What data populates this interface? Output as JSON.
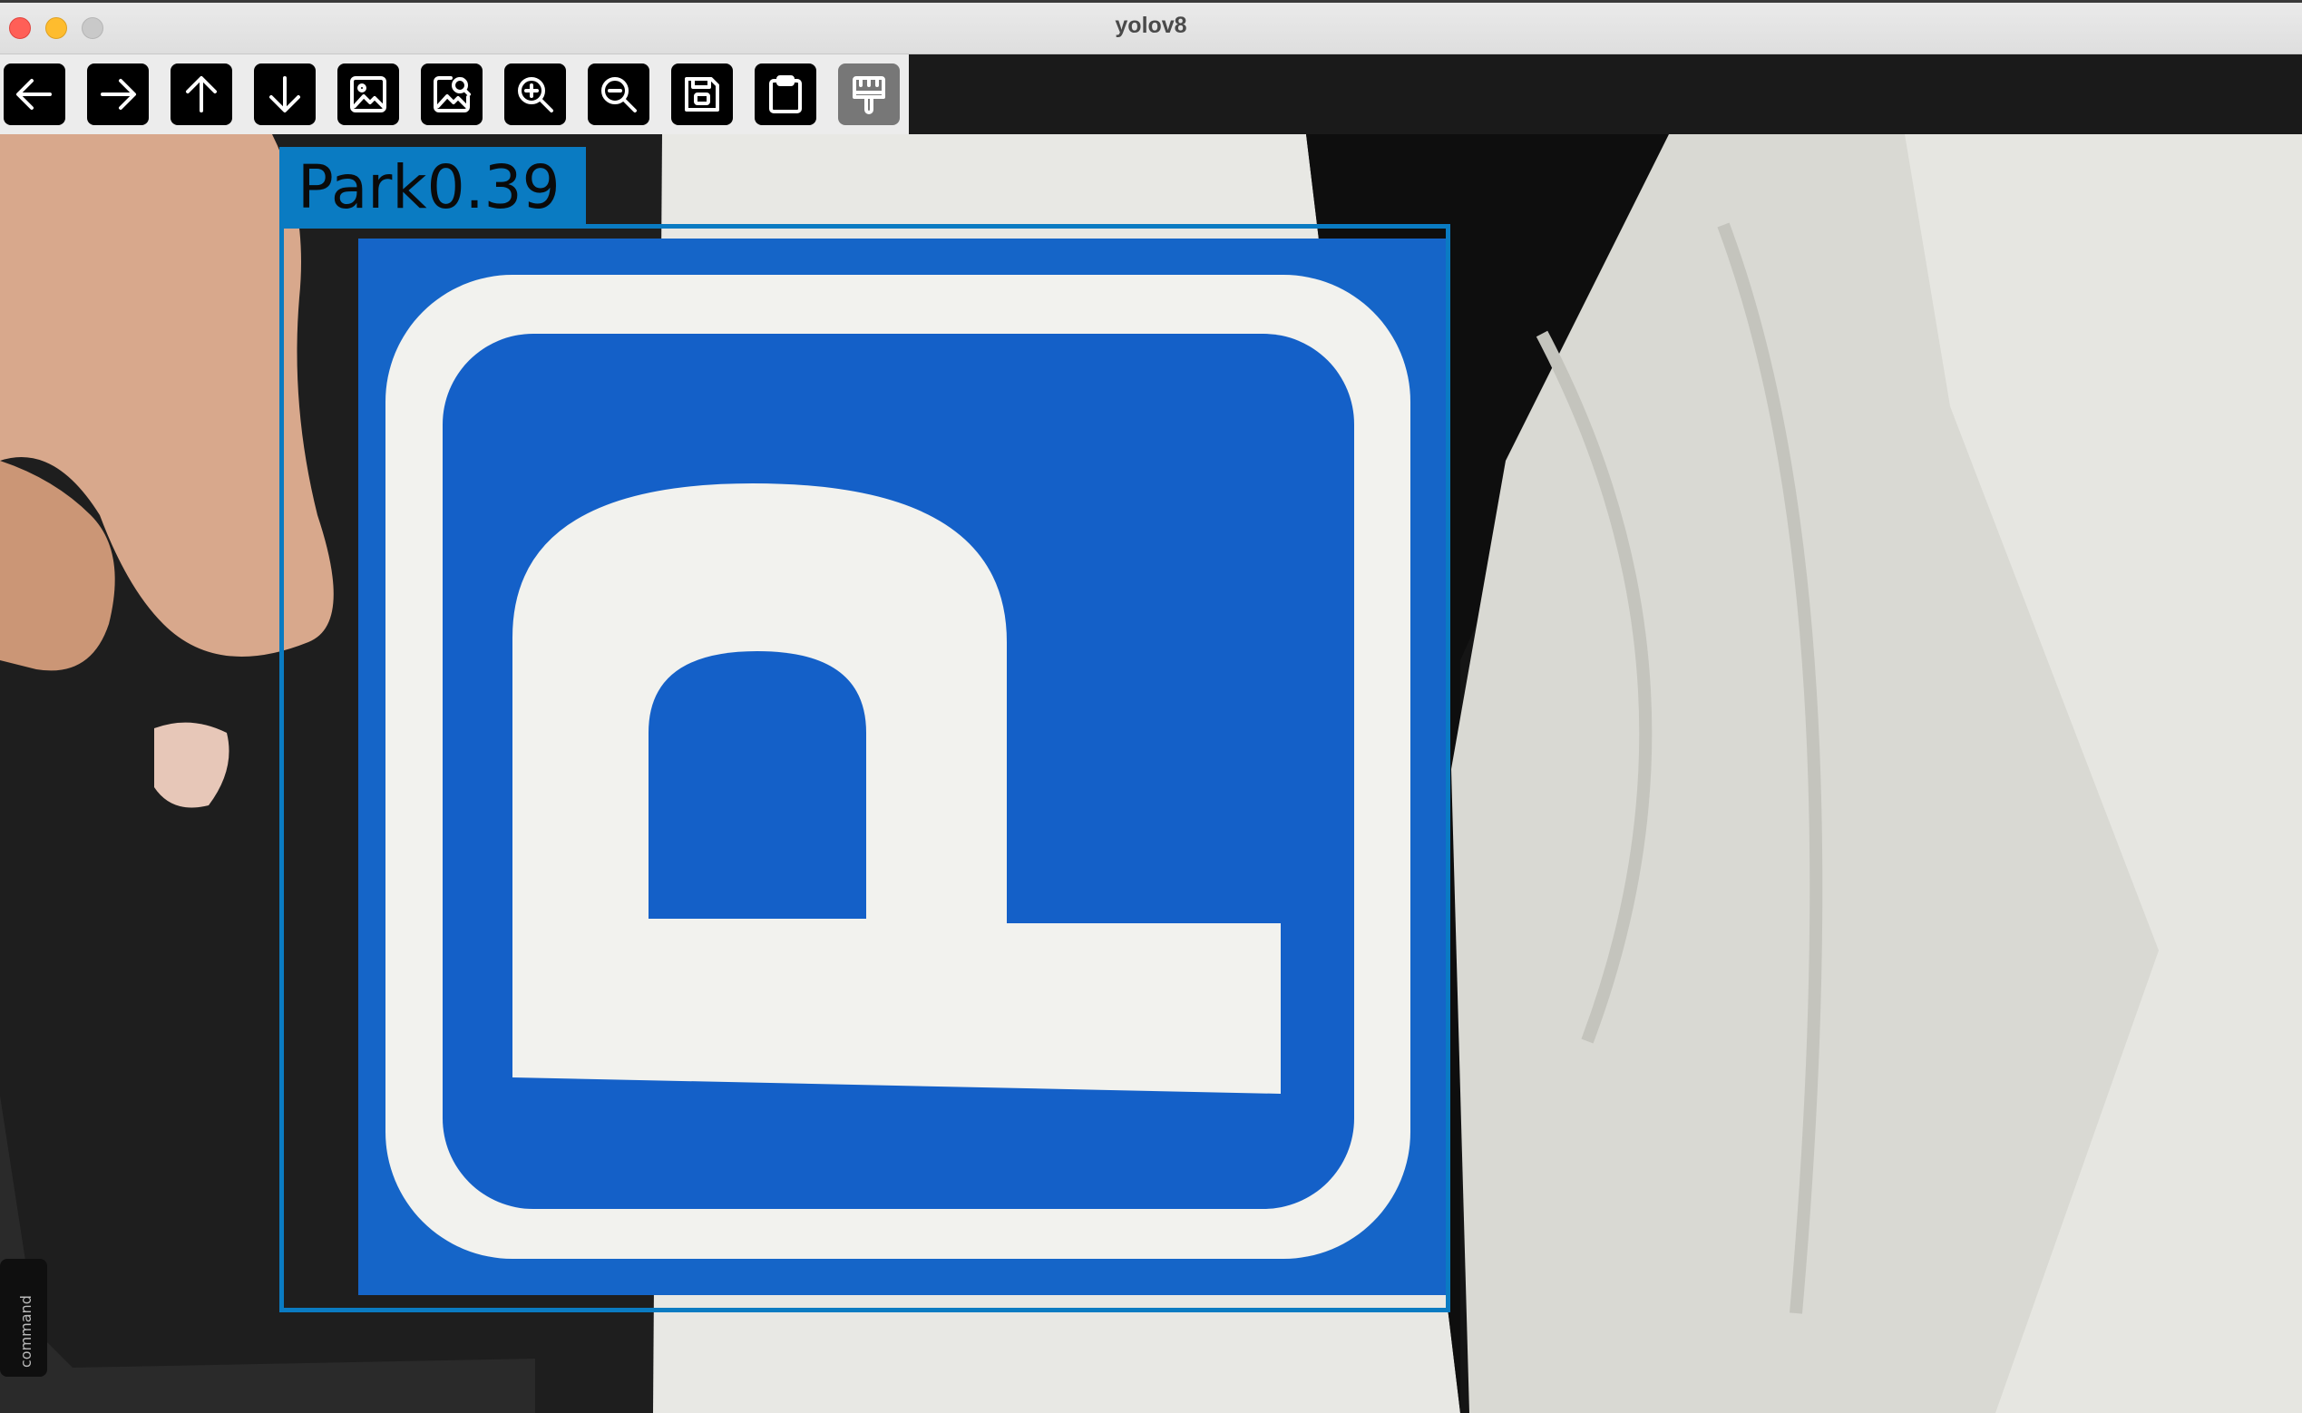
{
  "window": {
    "title": "yolov8"
  },
  "toolbar": {
    "buttons": [
      {
        "name": "back-button",
        "icon": "arrow-left-icon",
        "enabled": true
      },
      {
        "name": "forward-button",
        "icon": "arrow-right-icon",
        "enabled": true
      },
      {
        "name": "up-button",
        "icon": "arrow-up-icon",
        "enabled": true
      },
      {
        "name": "down-button",
        "icon": "arrow-down-icon",
        "enabled": true
      },
      {
        "name": "image-button",
        "icon": "image-icon",
        "enabled": true
      },
      {
        "name": "image-zoom-button",
        "icon": "image-search-icon",
        "enabled": true
      },
      {
        "name": "zoom-in-button",
        "icon": "zoom-in-icon",
        "enabled": true
      },
      {
        "name": "zoom-out-button",
        "icon": "zoom-out-icon",
        "enabled": true
      },
      {
        "name": "save-button",
        "icon": "save-icon",
        "enabled": true
      },
      {
        "name": "clipboard-button",
        "icon": "clipboard-icon",
        "enabled": true
      },
      {
        "name": "brush-button",
        "icon": "brush-icon",
        "enabled": false
      }
    ]
  },
  "detection": {
    "label": "Park0.39",
    "class": "Park",
    "confidence": 0.39,
    "box_color": "#0a7bc2"
  },
  "scene": {
    "keyboard_key_label": "command"
  },
  "colors": {
    "sign_blue": "#1460c8",
    "sign_white": "#f2f2ee",
    "cloth": "#dcdcd6"
  }
}
